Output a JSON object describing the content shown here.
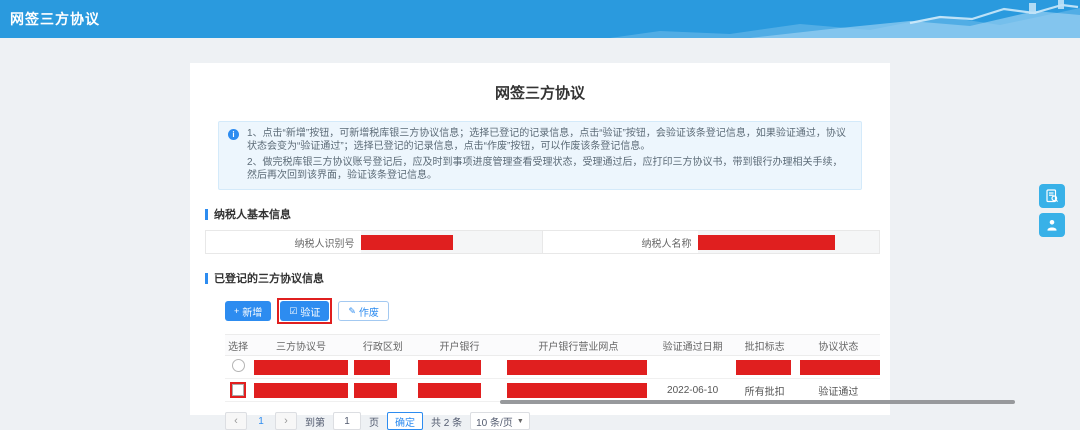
{
  "header": {
    "title": "网签三方协议"
  },
  "page": {
    "title": "网签三方协议"
  },
  "notice": {
    "line1": "1、点击“新增”按钮，可新增税库银三方协议信息；选择已登记的记录信息，点击“验证”按钮，会验证该条登记信息，如果验证通过，协议状态会变为“验证通过”；选择已登记的记录信息，点击“作废”按钮，可以作废该条登记信息。",
    "line2": "2、做完税库银三方协议账号登记后，应及时到事项进度管理查看受理状态，受理通过后，应打印三方协议书，带到银行办理相关手续，然后再次回到该界面，验证该条登记信息。"
  },
  "taxpayer_section": {
    "title": "纳税人基本信息",
    "fields": [
      {
        "label": "纳税人识别号",
        "redacted": true
      },
      {
        "label": "纳税人名称",
        "redacted": true
      }
    ]
  },
  "agreements_section": {
    "title": "已登记的三方协议信息",
    "buttons": {
      "add": "新增",
      "verify": "验证",
      "void": "作废"
    }
  },
  "table": {
    "headers": [
      "选择",
      "三方协议号",
      "行政区划",
      "开户银行",
      "开户银行营业网点",
      "验证通过日期",
      "批扣标志",
      "协议状态"
    ],
    "rows": [
      {
        "select_type": "radio",
        "verify_date": "",
        "deduct_flag": "",
        "status": "",
        "redacted": true
      },
      {
        "select_type": "checkbox",
        "verify_date": "2022-06-10",
        "deduct_flag": "所有批扣",
        "status": "验证通过",
        "redacted": true
      }
    ]
  },
  "pagination": {
    "current_page": "1",
    "goto_label": "到第",
    "goto_value": "1",
    "page_label": "页",
    "confirm": "确定",
    "total": "共 2 条",
    "page_size": "10 条/页"
  },
  "icons": {
    "info": "i",
    "add": "+",
    "verify": "☑",
    "void": "✎",
    "prev": "‹",
    "next": "›",
    "caret": "▼"
  },
  "colors": {
    "header_blue": "#2a9ade",
    "accent_blue": "#2d8cf0",
    "redaction_red": "#e01f1f",
    "annotation_red": "#e01f1f",
    "fab_blue": "#38b1e8",
    "notice_bg": "#edf6fd"
  }
}
